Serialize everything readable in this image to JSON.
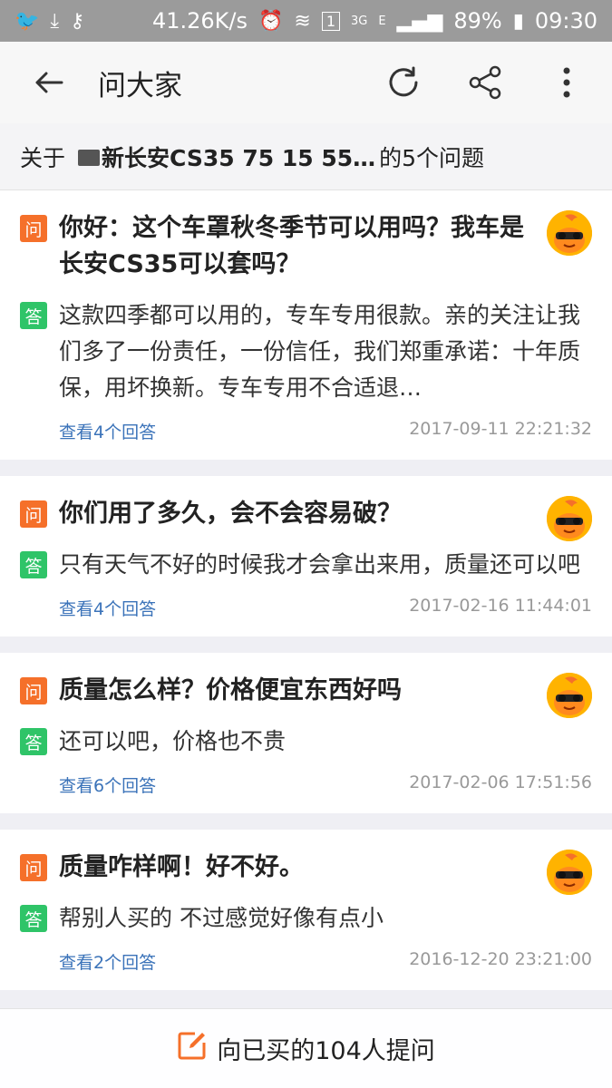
{
  "status_bar": {
    "net_speed": "41.26K/s",
    "sim": "1",
    "net_3g": "3G",
    "net_e": "E",
    "battery": "89%",
    "time": "09:30"
  },
  "header": {
    "title": "问大家"
  },
  "subheader": {
    "prefix": "关于",
    "product": "新长安CS35 75 15 55…",
    "suffix": "的5个问题"
  },
  "questions": [
    {
      "q": "你好：这个车罩秋冬季节可以用吗？我车是长安CS35可以套吗？",
      "a": "这款四季都可以用的，专车专用很款。亲的关注让我们多了一份责任，一份信任，我们郑重承诺：十年质保，用坏换新。专车专用不合适退…",
      "link": "查看4个回答",
      "time": "2017-09-11 22:21:32"
    },
    {
      "q": "你们用了多久，会不会容易破？",
      "a": "只有天气不好的时候我才会拿出来用，质量还可以吧",
      "link": "查看4个回答",
      "time": "2017-02-16 11:44:01"
    },
    {
      "q": "质量怎么样？价格便宜东西好吗",
      "a": "还可以吧，价格也不贵",
      "link": "查看6个回答",
      "time": "2017-02-06 17:51:56"
    },
    {
      "q": "质量咋样啊！好不好。",
      "a": "帮别人买的 不过感觉好像有点小",
      "link": "查看2个回答",
      "time": "2016-12-20 23:21:00"
    }
  ],
  "labels": {
    "question": "问",
    "answer": "答"
  },
  "bottom": {
    "ask_label": "向已买的104人提问"
  },
  "colors": {
    "accent": "#f5702a",
    "answer_badge": "#2fc468",
    "link": "#3b73b9"
  }
}
